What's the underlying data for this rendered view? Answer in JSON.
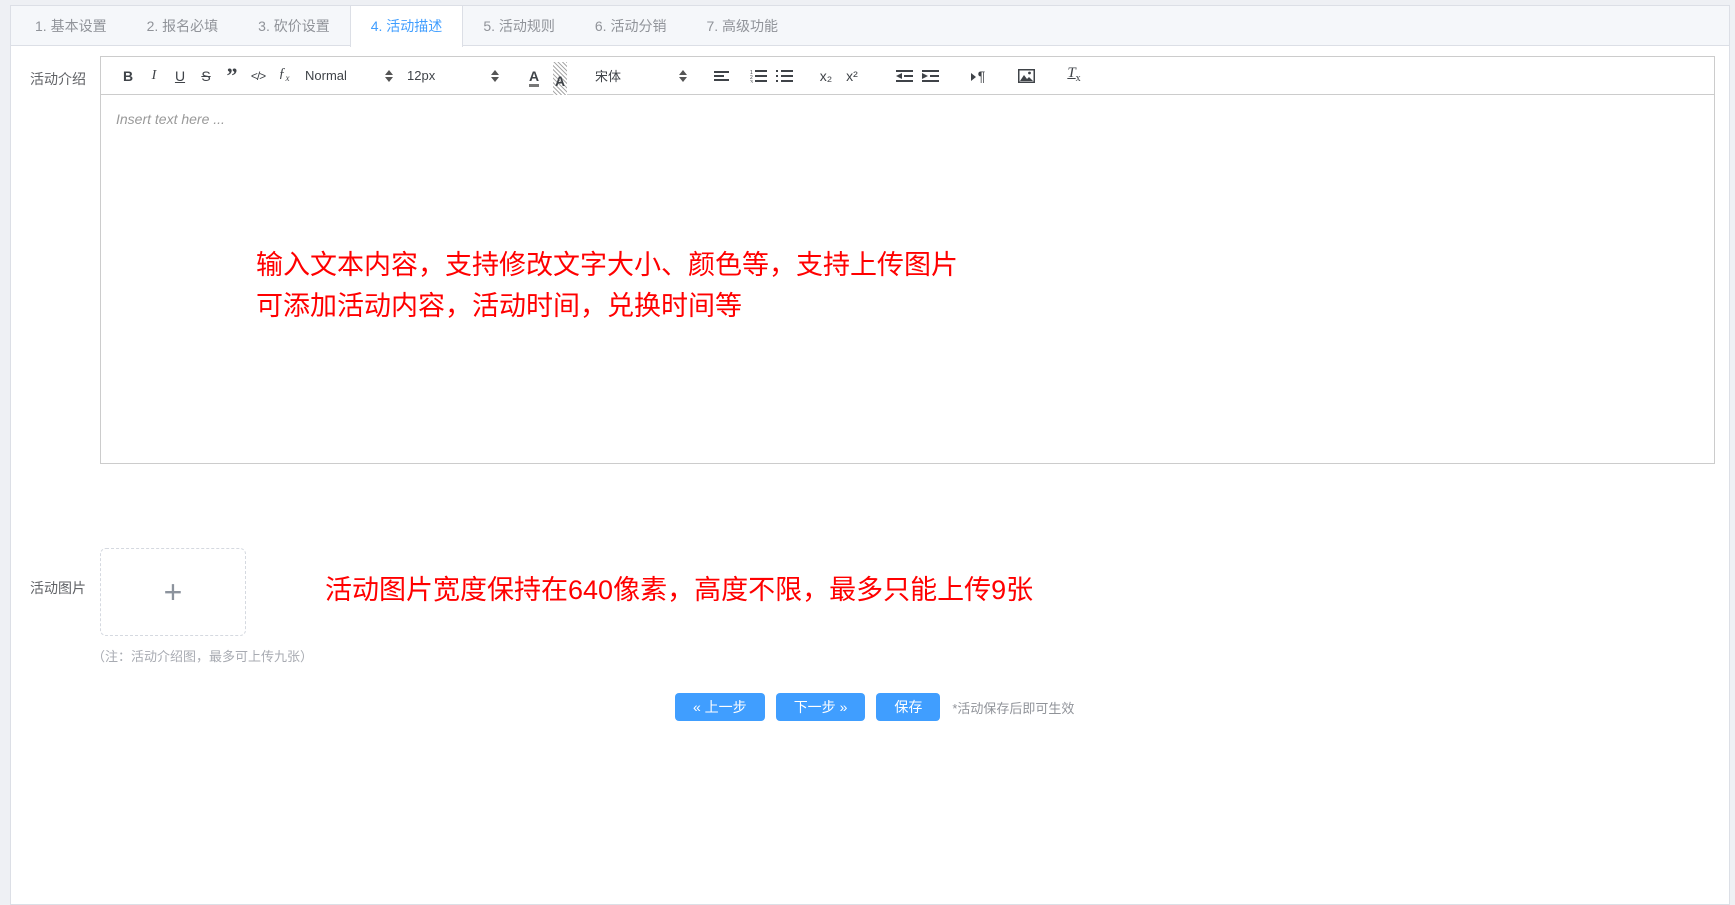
{
  "colors": {
    "accent": "#409eff",
    "annotation_red": "#ff0000",
    "tab_bar_bg": "#f5f7fa",
    "border": "#dcdfe6"
  },
  "tabs": {
    "active_index": 3,
    "items": [
      {
        "label": "1. 基本设置"
      },
      {
        "label": "2. 报名必填"
      },
      {
        "label": "3. 砍价设置"
      },
      {
        "label": "4. 活动描述"
      },
      {
        "label": "5. 活动规则"
      },
      {
        "label": "6. 活动分销"
      },
      {
        "label": "7. 高级功能"
      }
    ]
  },
  "form": {
    "intro_label": "活动介绍",
    "images_label": "活动图片"
  },
  "editor": {
    "placeholder": "Insert text here ...",
    "annotation_line1": "输入文本内容，支持修改文字大小、颜色等，支持上传图片",
    "annotation_line2": "可添加活动内容，活动时间，兑换时间等",
    "toolbar": {
      "bold": "B",
      "italic": "I",
      "underline": "U",
      "strike": "S",
      "blockquote": "”",
      "code": "</>",
      "formula_f": "ƒ",
      "formula_x": "x",
      "paragraph_format": "Normal",
      "font_size": "12px",
      "text_color": "A",
      "background_color": "A",
      "font_family": "宋体",
      "subscript": "x₂",
      "superscript": "x²",
      "direction": "¶",
      "clear_format_t": "T",
      "clear_format_x": "x",
      "svg_icons": [
        "align-icon",
        "ordered-list-icon",
        "bullet-list-icon",
        "outdent-icon",
        "indent-icon",
        "image-icon"
      ]
    }
  },
  "upload": {
    "plus": "+",
    "hint": "活动图片宽度保持在640像素，高度不限，最多只能上传9张",
    "note": "（注：活动介绍图，最多可上传九张）"
  },
  "footer": {
    "prev": "« 上一步",
    "next": "下一步 »",
    "save": "保存",
    "hint": "*活动保存后即可生效"
  }
}
